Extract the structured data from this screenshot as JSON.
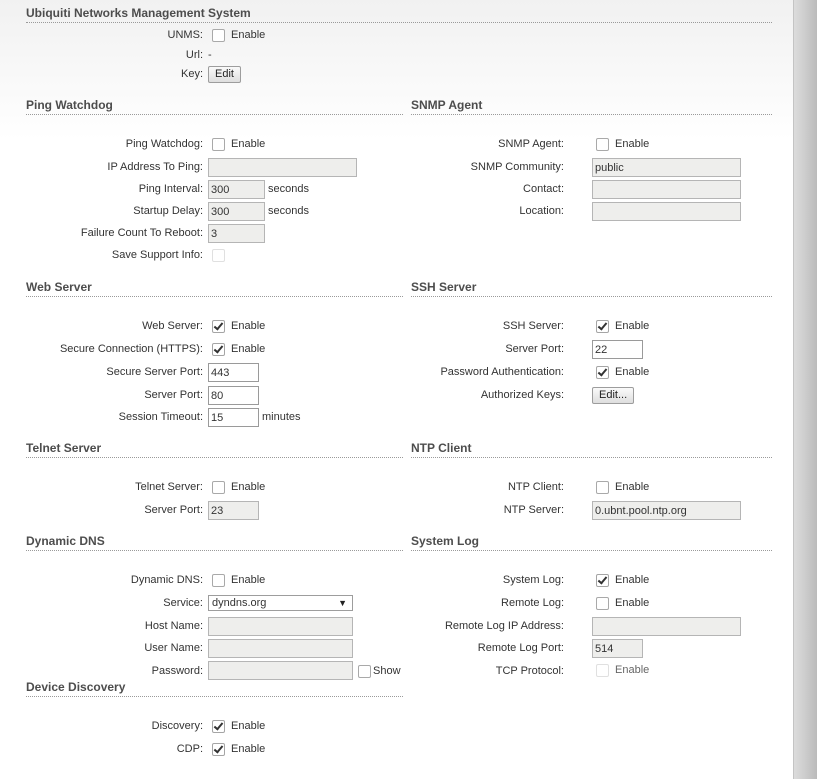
{
  "unms": {
    "title": "Ubiquiti Networks Management System",
    "unms_label": "UNMS:",
    "enable": "Enable",
    "url_label": "Url:",
    "url_value": "-",
    "key_label": "Key:",
    "edit": "Edit"
  },
  "ping": {
    "title": "Ping Watchdog",
    "watchdog_label": "Ping Watchdog:",
    "enable": "Enable",
    "ip_label": "IP Address To Ping:",
    "ip_value": "",
    "interval_label": "Ping Interval:",
    "interval_value": "300",
    "startup_label": "Startup Delay:",
    "startup_value": "300",
    "seconds": "seconds",
    "failure_label": "Failure Count To Reboot:",
    "failure_value": "3",
    "support_label": "Save Support Info:"
  },
  "snmp": {
    "title": "SNMP Agent",
    "agent_label": "SNMP Agent:",
    "enable": "Enable",
    "community_label": "SNMP Community:",
    "community_value": "public",
    "contact_label": "Contact:",
    "contact_value": "",
    "location_label": "Location:",
    "location_value": ""
  },
  "web": {
    "title": "Web Server",
    "server_label": "Web Server:",
    "enable": "Enable",
    "https_label": "Secure Connection (HTTPS):",
    "secure_port_label": "Secure Server Port:",
    "secure_port_value": "443",
    "port_label": "Server Port:",
    "port_value": "80",
    "timeout_label": "Session Timeout:",
    "timeout_value": "15",
    "minutes": "minutes"
  },
  "ssh": {
    "title": "SSH Server",
    "server_label": "SSH Server:",
    "enable": "Enable",
    "port_label": "Server Port:",
    "port_value": "22",
    "password_label": "Password Authentication:",
    "keys_label": "Authorized Keys:",
    "edit": "Edit..."
  },
  "telnet": {
    "title": "Telnet Server",
    "server_label": "Telnet Server:",
    "enable": "Enable",
    "port_label": "Server Port:",
    "port_value": "23"
  },
  "ntp": {
    "title": "NTP Client",
    "client_label": "NTP Client:",
    "enable": "Enable",
    "server_label": "NTP Server:",
    "server_value": "0.ubnt.pool.ntp.org"
  },
  "ddns": {
    "title": "Dynamic DNS",
    "ddns_label": "Dynamic DNS:",
    "enable": "Enable",
    "service_label": "Service:",
    "service_value": "dyndns.org",
    "host_label": "Host Name:",
    "host_value": "",
    "user_label": "User Name:",
    "user_value": "",
    "password_label": "Password:",
    "password_value": "",
    "show": "Show"
  },
  "syslog": {
    "title": "System Log",
    "log_label": "System Log:",
    "enable": "Enable",
    "remote_label": "Remote Log:",
    "remote_ip_label": "Remote Log IP Address:",
    "remote_ip_value": "",
    "remote_port_label": "Remote Log Port:",
    "remote_port_value": "514",
    "tcp_label": "TCP Protocol:"
  },
  "discovery": {
    "title": "Device Discovery",
    "discovery_label": "Discovery:",
    "enable": "Enable",
    "cdp_label": "CDP:"
  }
}
